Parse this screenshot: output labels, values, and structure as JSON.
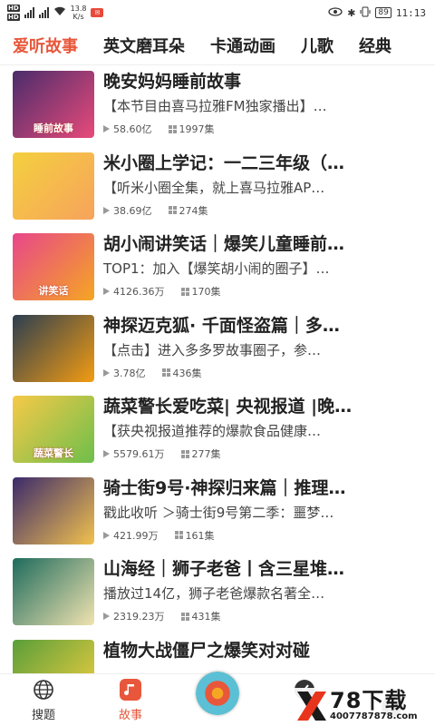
{
  "status_bar": {
    "netspeed_top": "13.8",
    "netspeed_bottom": "K/s",
    "battery": "89",
    "time": "11:13"
  },
  "tabs": [
    {
      "label": "爱听故事",
      "active": true
    },
    {
      "label": "英文磨耳朵"
    },
    {
      "label": "卡通动画"
    },
    {
      "label": "儿歌"
    },
    {
      "label": "经典"
    }
  ],
  "items": [
    {
      "title": "晚安妈妈睡前故事",
      "desc": "【本节目由喜马拉雅FM独家播出】…",
      "plays": "58.60亿",
      "episodes": "1997集",
      "cover_label": "睡前故事",
      "cover_colors": [
        "#4a2c6b",
        "#e84a7a"
      ]
    },
    {
      "title": "米小圈上学记：一二三年级（…",
      "desc": "【听米小圈全集，就上喜马拉雅AP…",
      "plays": "38.69亿",
      "episodes": "274集",
      "cover_label": "",
      "cover_colors": [
        "#f4d03f",
        "#f7a35c"
      ]
    },
    {
      "title": "胡小闹讲笑话｜爆笑儿童睡前…",
      "desc": "TOP1：加入【爆笑胡小闹的圈子】…",
      "plays": "4126.36万",
      "episodes": "170集",
      "cover_label": "讲笑话",
      "cover_colors": [
        "#e8468a",
        "#f5a623"
      ]
    },
    {
      "title": "神探迈克狐· 千面怪盗篇｜多…",
      "desc": "【点击】进入多多罗故事圈子，参…",
      "plays": "3.78亿",
      "episodes": "436集",
      "cover_label": "",
      "cover_colors": [
        "#2c3e50",
        "#f39c12"
      ]
    },
    {
      "title": "蔬菜警长爱吃菜| 央视报道 |晚…",
      "desc": "【获央视报道推荐的爆款食品健康…",
      "plays": "5579.61万",
      "episodes": "277集",
      "cover_label": "蔬菜警长",
      "cover_colors": [
        "#f7c948",
        "#6dbf4b"
      ]
    },
    {
      "title": "骑士街9号·神探归来篇｜推理…",
      "desc": "戳此收听 ＞骑士街9号第二季：噩梦…",
      "plays": "421.99万",
      "episodes": "161集",
      "cover_label": "",
      "cover_colors": [
        "#3b2a6b",
        "#f2c14e"
      ]
    },
    {
      "title": "山海经｜狮子老爸丨含三星堆…",
      "desc": "播放过14亿，狮子老爸爆款名著全…",
      "plays": "2319.23万",
      "episodes": "431集",
      "cover_label": "",
      "cover_colors": [
        "#1e6b5c",
        "#f1e3b0"
      ]
    },
    {
      "title": "植物大战僵尸之爆笑对对碰",
      "desc": "",
      "plays": "",
      "episodes": "",
      "cover_label": "",
      "cover_colors": [
        "#5a9e3a",
        "#f4d03f"
      ]
    }
  ],
  "bottom_nav": [
    {
      "label": "搜题",
      "icon": "globe-icon",
      "active": false
    },
    {
      "label": "故事",
      "icon": "music-note-icon",
      "active": true
    },
    {
      "label": "",
      "icon": "player-disc-icon",
      "active": false
    },
    {
      "label": "学",
      "icon": "feather-icon",
      "active": false
    },
    {
      "label": "",
      "icon": "profile-icon",
      "active": false
    }
  ],
  "watermark": {
    "top": "78下载",
    "bottom": "4007787878.com",
    "colors": {
      "x_dark": "#1a1a1a",
      "x_red": "#e8341c"
    }
  },
  "colors": {
    "accent": "#e8573b"
  }
}
